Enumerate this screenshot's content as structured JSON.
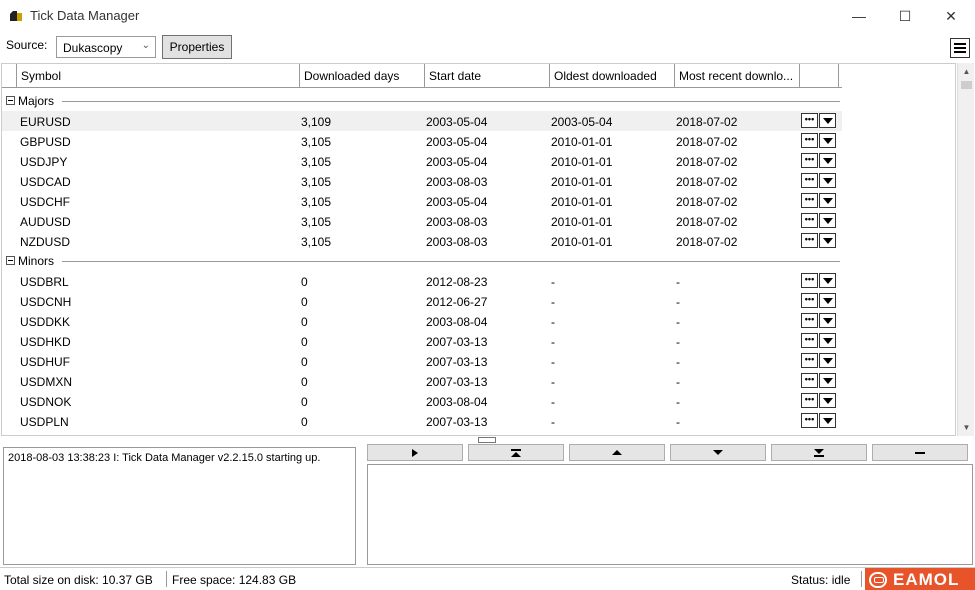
{
  "window": {
    "title": "Tick Data Manager",
    "minimize_glyph": "—",
    "maximize_glyph": "☐",
    "close_glyph": "✕"
  },
  "toolbar": {
    "source_label": "Source:",
    "source_value": "Dukascopy",
    "properties_label": "Properties"
  },
  "grid": {
    "columns": [
      "Symbol",
      "Downloaded days",
      "Start date",
      "Oldest downloaded",
      "Most recent downlo..."
    ],
    "groups": [
      {
        "name": "Majors",
        "rows": [
          {
            "symbol": "EURUSD",
            "days": "3,109",
            "start": "2003-05-04",
            "oldest": "2003-05-04",
            "recent": "2018-07-02"
          },
          {
            "symbol": "GBPUSD",
            "days": "3,105",
            "start": "2003-05-04",
            "oldest": "2010-01-01",
            "recent": "2018-07-02"
          },
          {
            "symbol": "USDJPY",
            "days": "3,105",
            "start": "2003-05-04",
            "oldest": "2010-01-01",
            "recent": "2018-07-02"
          },
          {
            "symbol": "USDCAD",
            "days": "3,105",
            "start": "2003-08-03",
            "oldest": "2010-01-01",
            "recent": "2018-07-02"
          },
          {
            "symbol": "USDCHF",
            "days": "3,105",
            "start": "2003-05-04",
            "oldest": "2010-01-01",
            "recent": "2018-07-02"
          },
          {
            "symbol": "AUDUSD",
            "days": "3,105",
            "start": "2003-08-03",
            "oldest": "2010-01-01",
            "recent": "2018-07-02"
          },
          {
            "symbol": "NZDUSD",
            "days": "3,105",
            "start": "2003-08-03",
            "oldest": "2010-01-01",
            "recent": "2018-07-02"
          }
        ]
      },
      {
        "name": "Minors",
        "rows": [
          {
            "symbol": "USDBRL",
            "days": "0",
            "start": "2012-08-23",
            "oldest": "-",
            "recent": "-"
          },
          {
            "symbol": "USDCNH",
            "days": "0",
            "start": "2012-06-27",
            "oldest": "-",
            "recent": "-"
          },
          {
            "symbol": "USDDKK",
            "days": "0",
            "start": "2003-08-04",
            "oldest": "-",
            "recent": "-"
          },
          {
            "symbol": "USDHKD",
            "days": "0",
            "start": "2007-03-13",
            "oldest": "-",
            "recent": "-"
          },
          {
            "symbol": "USDHUF",
            "days": "0",
            "start": "2007-03-13",
            "oldest": "-",
            "recent": "-"
          },
          {
            "symbol": "USDMXN",
            "days": "0",
            "start": "2007-03-13",
            "oldest": "-",
            "recent": "-"
          },
          {
            "symbol": "USDNOK",
            "days": "0",
            "start": "2003-08-04",
            "oldest": "-",
            "recent": "-"
          },
          {
            "symbol": "USDPLN",
            "days": "0",
            "start": "2007-03-13",
            "oldest": "-",
            "recent": "-"
          }
        ]
      }
    ],
    "row_menu_glyph": "•••"
  },
  "log": {
    "lines": [
      "2018-08-03 13:38:23  I: Tick Data Manager v2.2.15.0 starting up."
    ]
  },
  "status": {
    "total_size": "Total size on disk: 10.37 GB",
    "free_space": "Free space: 124.83 GB",
    "state": "Status: idle",
    "watermark": "EAMOL"
  }
}
